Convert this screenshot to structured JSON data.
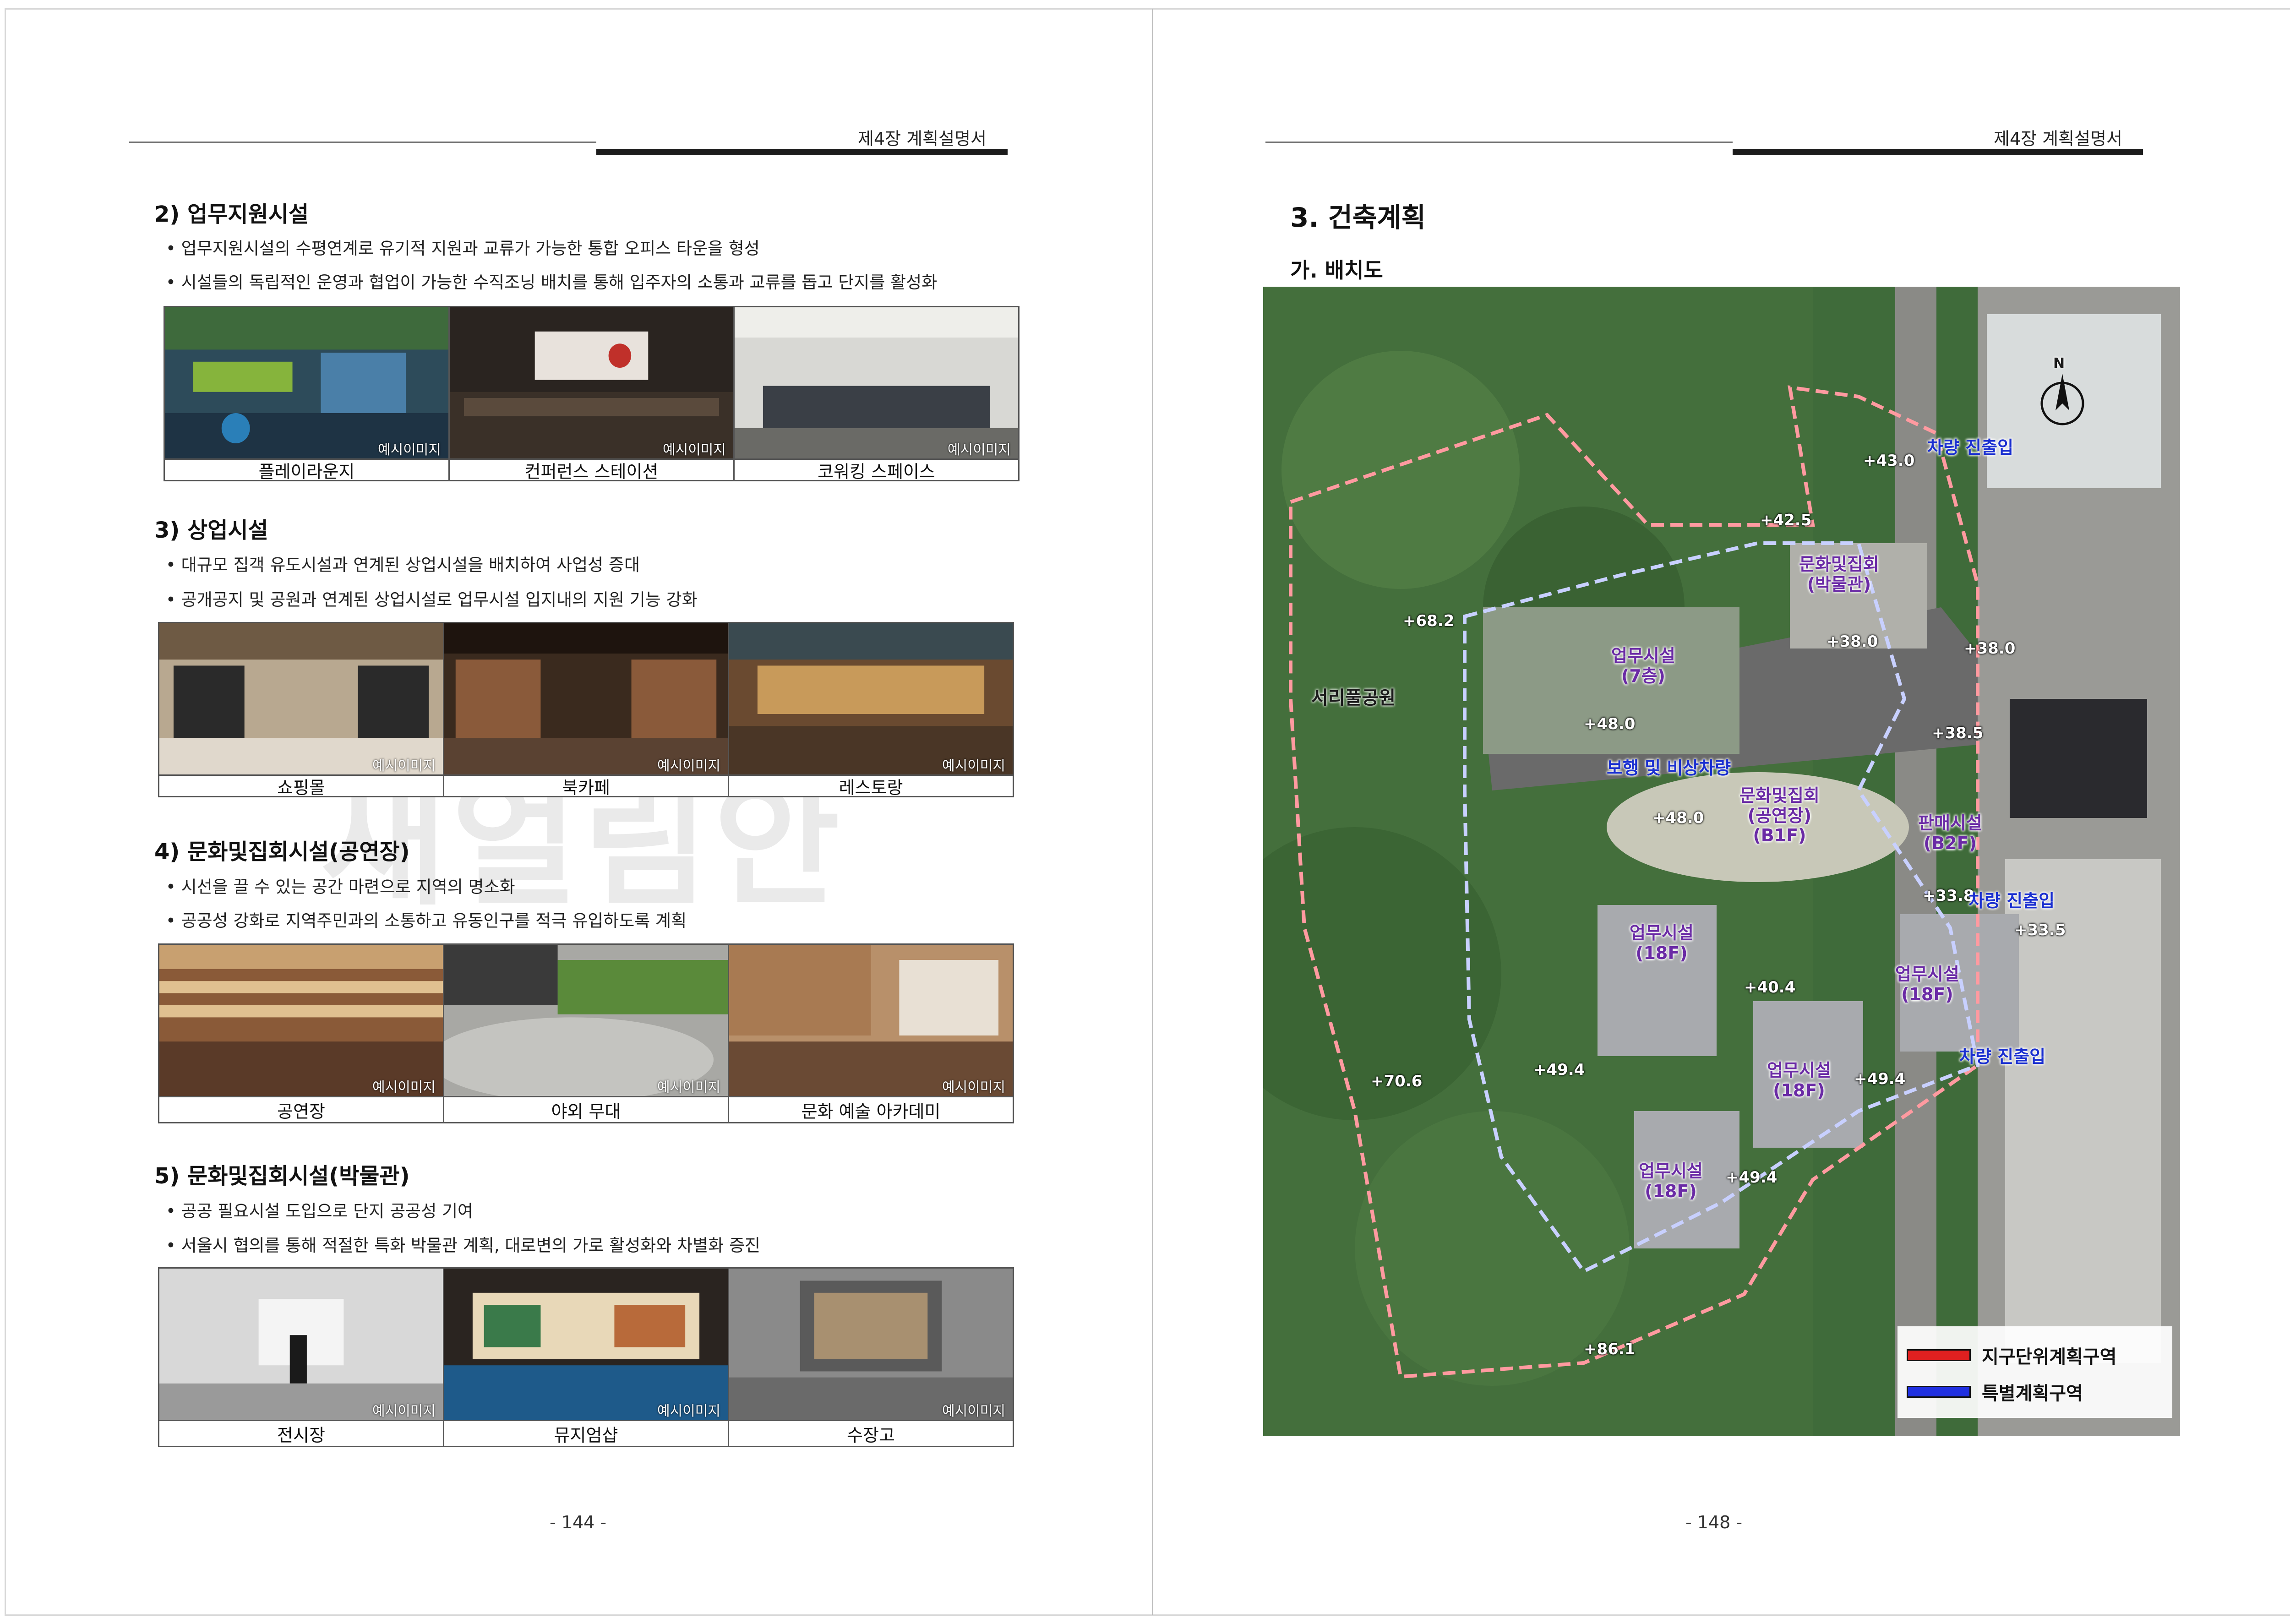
{
  "left_page": {
    "header": "제4장 계획설명서",
    "page_number": "- 144 -",
    "watermark_text": "새얼림안",
    "sections": [
      {
        "title": "2) 업무지원시설",
        "bullets": [
          "• 업무지원시설의 수평연계로 유기적 지원과 교류가 가능한 통합 오피스 타운을 형성",
          "• 시설들의 독립적인 운영과 협업이 가능한 수직조닝 배치를 통해 입주자의 소통과 교류를 돕고 단지를 활성화"
        ],
        "photos": [
          {
            "caption": "플레이라운지",
            "tag": "예시이미지"
          },
          {
            "caption": "컨퍼런스 스테이션",
            "tag": "예시이미지"
          },
          {
            "caption": "코워킹 스페이스",
            "tag": "예시이미지"
          }
        ]
      },
      {
        "title": "3) 상업시설",
        "bullets": [
          "•  대규모 집객 유도시설과 연계된 상업시설을 배치하여 사업성 증대",
          "•  공개공지 및 공원과 연계된 상업시설로 업무시설 입지내의 지원 기능 강화"
        ],
        "photos": [
          {
            "caption": "쇼핑몰",
            "tag": "예시이미지"
          },
          {
            "caption": "북카페",
            "tag": "예시이미지"
          },
          {
            "caption": "레스토랑",
            "tag": "예시이미지"
          }
        ]
      },
      {
        "title": "4) 문화및집회시설(공연장)",
        "bullets": [
          "• 시선을 끌 수 있는 공간 마련으로 지역의 명소화",
          "• 공공성 강화로 지역주민과의 소통하고 유동인구를 적극 유입하도록 계획"
        ],
        "photos": [
          {
            "caption": "공연장",
            "tag": "예시이미지"
          },
          {
            "caption": "야외 무대",
            "tag": "예시이미지"
          },
          {
            "caption": "문화 예술 아카데미",
            "tag": "예시이미지"
          }
        ]
      },
      {
        "title": "5) 문화및집회시설(박물관)",
        "bullets": [
          "• 공공 필요시설 도입으로 단지 공공성 기여",
          "• 서울시 협의를 통해 적절한 특화 박물관 계획, 대로변의 가로 활성화와 차별화 증진"
        ],
        "photos": [
          {
            "caption": "전시장",
            "tag": "예시이미지"
          },
          {
            "caption": "뮤지엄샵",
            "tag": "예시이미지"
          },
          {
            "caption": "수장고",
            "tag": "예시이미지"
          }
        ]
      }
    ]
  },
  "right_page": {
    "header": "제4장 계획설명서",
    "page_number": "- 148 -",
    "title": "3. 건축계획",
    "subtitle": "가. 배치도",
    "map": {
      "north_label": "N",
      "park_label": "서리풀공원",
      "buildings": [
        {
          "name": "업무시설",
          "floors": "(7층)"
        },
        {
          "name": "문화및집회",
          "floors": "(박물관)"
        },
        {
          "name": "문화및집회",
          "floors": "(공연장)",
          "extra": "(B1F)"
        },
        {
          "name": "판매시설",
          "floors": "(B2F)"
        },
        {
          "name": "업무시설",
          "floors": "(18F)"
        },
        {
          "name": "업무시설",
          "floors": "(18F)"
        },
        {
          "name": "업무시설",
          "floors": "(18F)"
        },
        {
          "name": "업무시설",
          "floors": "(18F)"
        }
      ],
      "elevations": [
        "+43.0",
        "+42.5",
        "+68.2",
        "+38.0",
        "+38.0",
        "+48.0",
        "+38.5",
        "+48.0",
        "+33.8",
        "+33.5",
        "+40.4",
        "+49.4",
        "+49.4",
        "+70.6",
        "+49.4",
        "+86.1"
      ],
      "access_labels": [
        "차량 진출입",
        "보행 및 비상차량",
        "차량 진출입",
        "차량 진출입"
      ],
      "legend": [
        {
          "label": "지구단위계획구역",
          "color": "#e02020"
        },
        {
          "label": "특별계획구역",
          "color": "#2030e0"
        }
      ]
    }
  }
}
